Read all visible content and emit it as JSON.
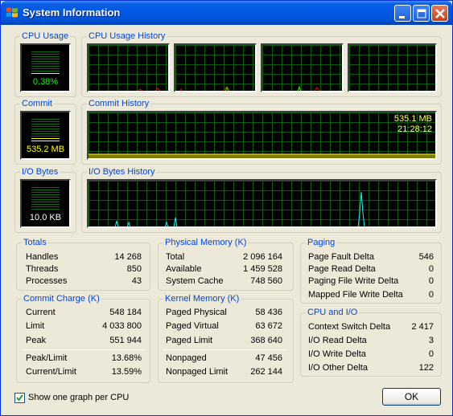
{
  "window": {
    "title": "System Information"
  },
  "cpu": {
    "usage_label": "CPU Usage",
    "usage_value": "0.38%",
    "history_label": "CPU Usage History"
  },
  "commit": {
    "label": "Commit",
    "value": "535.2 MB",
    "history_label": "Commit History",
    "overlay_value": "535.1 MB",
    "overlay_time": "21:28:12"
  },
  "io": {
    "label": "I/O Bytes",
    "value": "10.0  KB",
    "history_label": "I/O Bytes History"
  },
  "totals": {
    "label": "Totals",
    "rows": [
      {
        "k": "Handles",
        "v": "14 268"
      },
      {
        "k": "Threads",
        "v": "850"
      },
      {
        "k": "Processes",
        "v": "43"
      }
    ]
  },
  "physical": {
    "label": "Physical Memory (K)",
    "rows": [
      {
        "k": "Total",
        "v": "2 096 164"
      },
      {
        "k": "Available",
        "v": "1 459 528"
      },
      {
        "k": "System Cache",
        "v": "748 560"
      }
    ]
  },
  "paging": {
    "label": "Paging",
    "rows": [
      {
        "k": "Page Fault Delta",
        "v": "546"
      },
      {
        "k": "Page Read Delta",
        "v": "0"
      },
      {
        "k": "Paging File Write Delta",
        "v": "0"
      },
      {
        "k": "Mapped File Write Delta",
        "v": "0"
      }
    ]
  },
  "commit_charge": {
    "label": "Commit Charge (K)",
    "rows": [
      {
        "k": "Current",
        "v": "548 184"
      },
      {
        "k": "Limit",
        "v": "4 033 800"
      },
      {
        "k": "Peak",
        "v": "551 944"
      },
      {
        "k": "Peak/Limit",
        "v": "13.68%"
      },
      {
        "k": "Current/Limit",
        "v": "13.59%"
      }
    ]
  },
  "kernel": {
    "label": "Kernel Memory (K)",
    "rows": [
      {
        "k": "Paged Physical",
        "v": "58 436"
      },
      {
        "k": "Paged Virtual",
        "v": "63 672"
      },
      {
        "k": "Paged Limit",
        "v": "368 640"
      },
      {
        "k": "Nonpaged",
        "v": "47 456"
      },
      {
        "k": "Nonpaged Limit",
        "v": "262 144"
      }
    ]
  },
  "cpu_io": {
    "label": "CPU and I/O",
    "rows": [
      {
        "k": "Context Switch Delta",
        "v": "2 417"
      },
      {
        "k": "I/O Read Delta",
        "v": "3"
      },
      {
        "k": "I/O Write Delta",
        "v": "0"
      },
      {
        "k": "I/O Other Delta",
        "v": "122"
      }
    ]
  },
  "footer": {
    "checkbox_label": "Show one graph per CPU",
    "checkbox_checked": true,
    "ok_label": "OK"
  },
  "colors": {
    "graph_grid": "#0b5b0b",
    "gauge_text": "#00ff00",
    "commit_text": "#ffff00",
    "cpu_spike": "#ff0000",
    "io_spike": "#00ffff"
  }
}
